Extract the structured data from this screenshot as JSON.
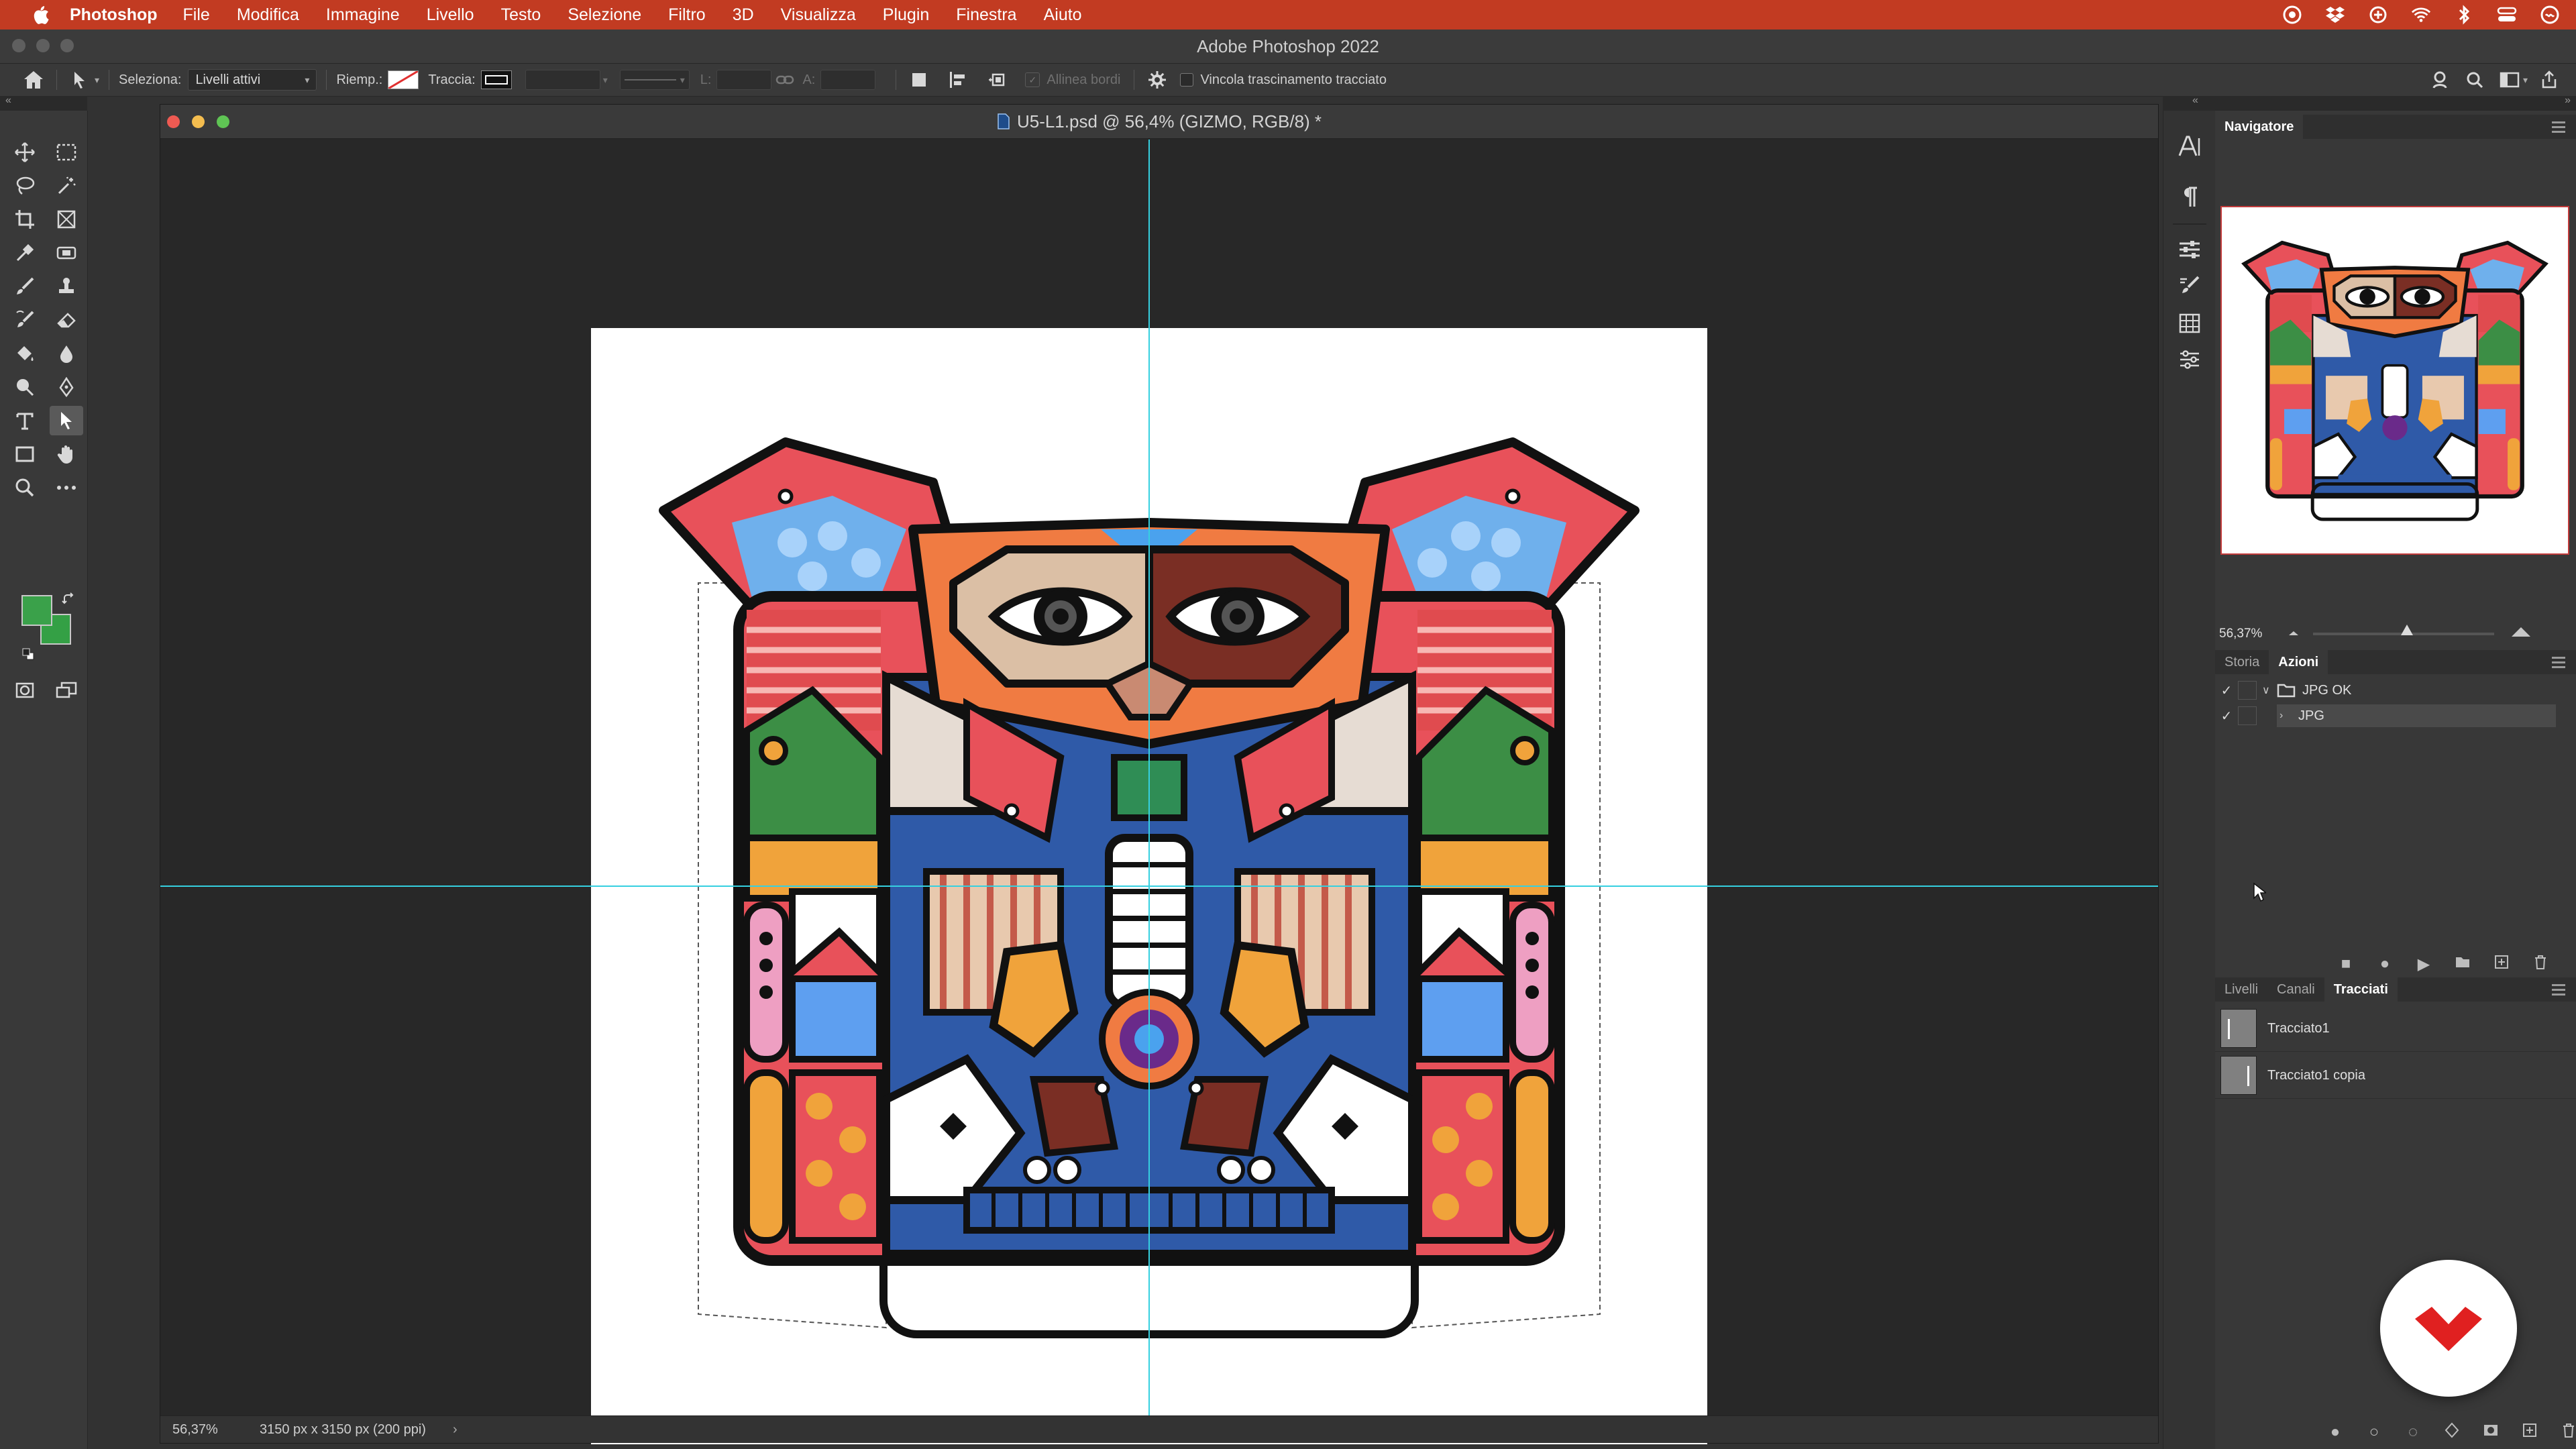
{
  "menubar": {
    "app_name": "Photoshop",
    "items": [
      "File",
      "Modifica",
      "Immagine",
      "Livello",
      "Testo",
      "Selezione",
      "Filtro",
      "3D",
      "Visualizza",
      "Plugin",
      "Finestra",
      "Aiuto"
    ]
  },
  "app": {
    "title": "Adobe Photoshop 2022"
  },
  "options": {
    "seleziona_label": "Seleziona:",
    "seleziona_value": "Livelli attivi",
    "riemp_label": "Riemp.:",
    "traccia_label": "Traccia:",
    "l_label": "L:",
    "a_label": "A:",
    "allinea_label": "Allinea bordi",
    "vincola_label": "Vincola trascinamento tracciato"
  },
  "colors": {
    "foreground": "#3aa14a",
    "background": "#34a045",
    "accent_menu": "#c23b22",
    "guide": "#36d0e0"
  },
  "document": {
    "title": "U5-L1.psd @ 56,4% (GIZMO, RGB/8) *",
    "zoom": "56,37%",
    "info": "3150 px x 3150 px (200 ppi)"
  },
  "navigator": {
    "tab": "Navigatore",
    "zoom": "56,37%",
    "zoom_slider_fraction": 0.52
  },
  "history_actions": {
    "tabs": [
      "Storia",
      "Azioni"
    ],
    "active_tab": "Azioni",
    "items": [
      {
        "label": "JPG OK",
        "type": "set",
        "checked": true,
        "expanded": true
      },
      {
        "label": "JPG",
        "type": "action",
        "checked": true,
        "expanded": false
      }
    ]
  },
  "layers_panel": {
    "tabs": [
      "Livelli",
      "Canali",
      "Tracciati"
    ],
    "active_tab": "Tracciati",
    "paths": [
      {
        "label": "Tracciato1"
      },
      {
        "label": "Tracciato1 copia"
      }
    ]
  },
  "icons": {
    "tools": [
      "move-icon",
      "marquee-icon",
      "lasso-icon",
      "magic-wand-icon",
      "crop-icon",
      "frame-icon",
      "eyedropper-icon",
      "patch-icon",
      "brush-icon",
      "stamp-icon",
      "history-brush-icon",
      "eraser-icon",
      "bucket-icon",
      "blur-icon",
      "dodge-icon",
      "pen-icon",
      "type-icon",
      "path-select-icon",
      "rectangle-icon",
      "hand-icon",
      "zoom-icon",
      "more-icon"
    ]
  }
}
